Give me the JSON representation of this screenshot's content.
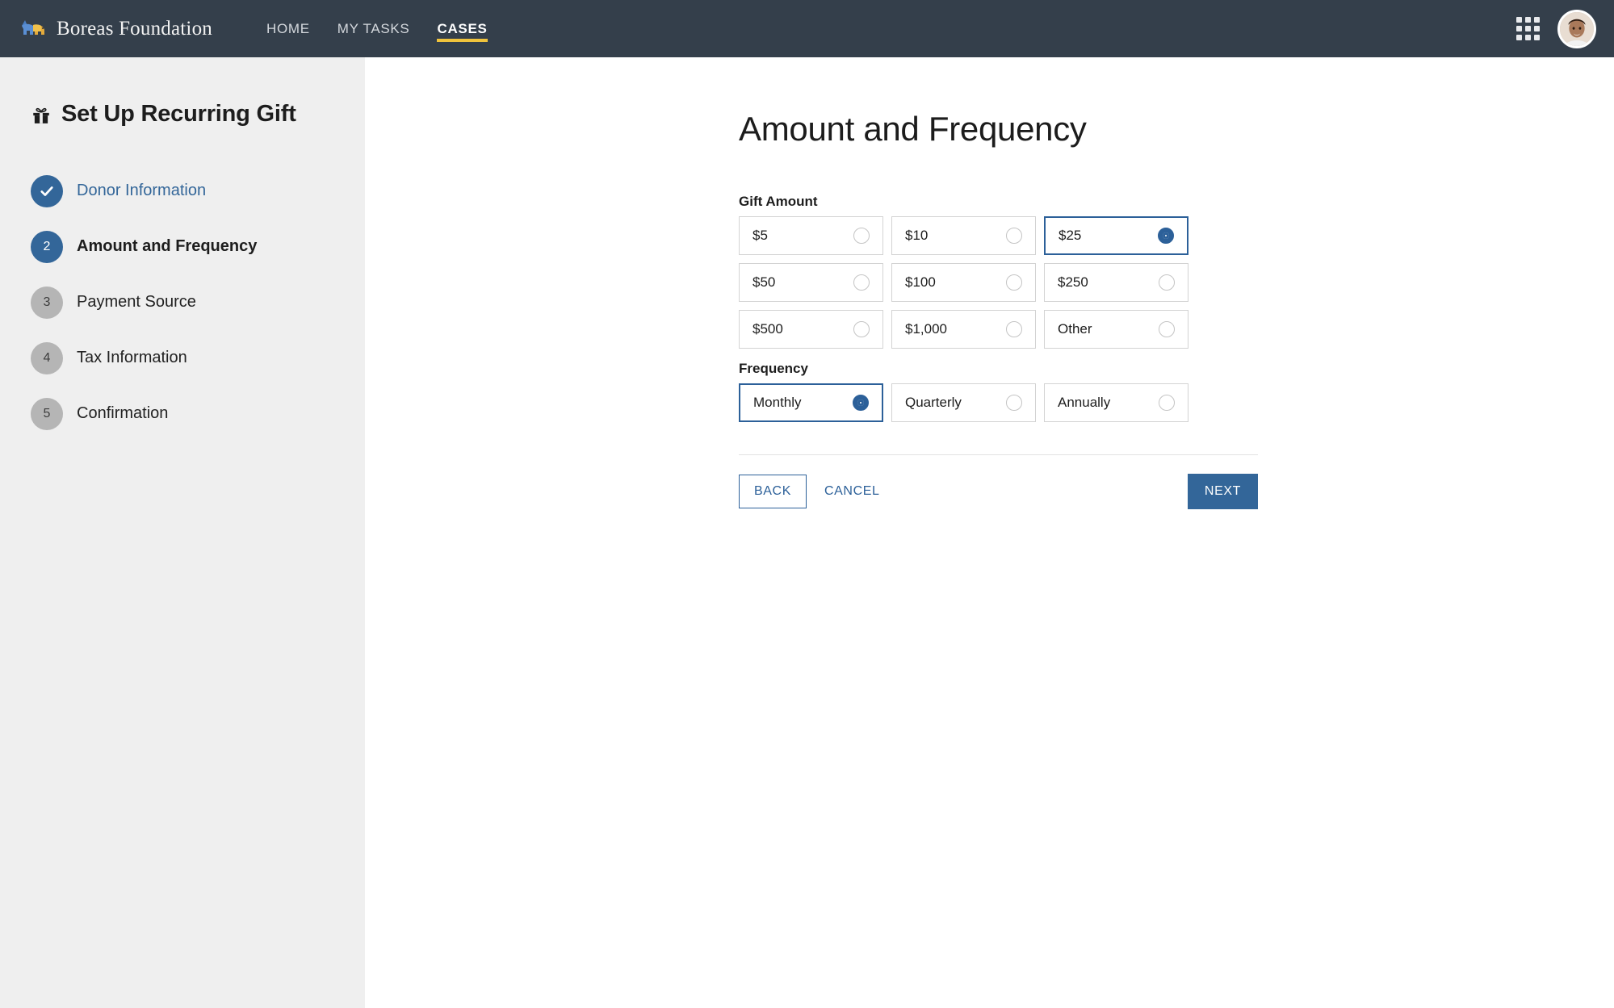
{
  "header": {
    "brand": "Boreas Foundation",
    "logo_icon": "bear-logo-icon",
    "nav": [
      {
        "label": "HOME",
        "active": false
      },
      {
        "label": "MY TASKS",
        "active": false
      },
      {
        "label": "CASES",
        "active": true
      }
    ],
    "apps_icon": "grid-apps-icon",
    "avatar_icon": "user-avatar",
    "colors": {
      "background": "#343f4b",
      "active_underline": "#f0c33c",
      "nav_text": "#d4d8dd"
    }
  },
  "sidebar": {
    "icon": "gift-icon",
    "title": "Set Up Recurring Gift",
    "background": "#efefef",
    "steps": [
      {
        "number": "",
        "label": "Donor Information",
        "state": "done",
        "icon": "check-icon"
      },
      {
        "number": "2",
        "label": "Amount and Frequency",
        "state": "current"
      },
      {
        "number": "3",
        "label": "Payment Source",
        "state": "todo"
      },
      {
        "number": "4",
        "label": "Tax Information",
        "state": "todo"
      },
      {
        "number": "5",
        "label": "Confirmation",
        "state": "todo"
      }
    ]
  },
  "main": {
    "page_title": "Amount and Frequency",
    "accent_color": "#336699",
    "gift_amount": {
      "label": "Gift Amount",
      "selected": "$25",
      "options": [
        {
          "label": "$5",
          "selected": false
        },
        {
          "label": "$10",
          "selected": false
        },
        {
          "label": "$25",
          "selected": true
        },
        {
          "label": "$50",
          "selected": false
        },
        {
          "label": "$100",
          "selected": false
        },
        {
          "label": "$250",
          "selected": false
        },
        {
          "label": "$500",
          "selected": false
        },
        {
          "label": "$1,000",
          "selected": false
        },
        {
          "label": "Other",
          "selected": false
        }
      ]
    },
    "frequency": {
      "label": "Frequency",
      "selected": "Monthly",
      "options": [
        {
          "label": "Monthly",
          "selected": true
        },
        {
          "label": "Quarterly",
          "selected": false
        },
        {
          "label": "Annually",
          "selected": false
        }
      ]
    },
    "actions": {
      "back": "BACK",
      "cancel": "CANCEL",
      "next": "NEXT"
    }
  }
}
